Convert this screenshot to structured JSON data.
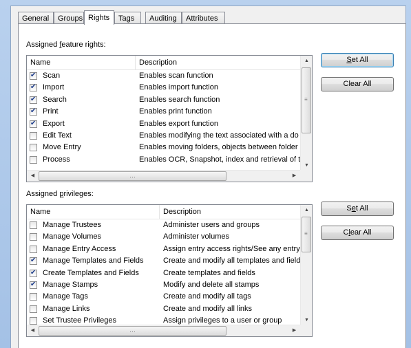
{
  "tabs": [
    {
      "label": "General"
    },
    {
      "label": "Groups"
    },
    {
      "label": "Rights"
    },
    {
      "label": "Tags"
    },
    {
      "label": "Auditing"
    },
    {
      "label": "Attributes"
    }
  ],
  "features": {
    "label_pre": "Assigned ",
    "label_key": "f",
    "label_post": "eature rights:",
    "columns": {
      "name": "Name",
      "description": "Description"
    },
    "rows": [
      {
        "name": "Scan",
        "description": "Enables scan function",
        "checked": true
      },
      {
        "name": "Import",
        "description": "Enables import function",
        "checked": true
      },
      {
        "name": "Search",
        "description": "Enables search function",
        "checked": true
      },
      {
        "name": "Print",
        "description": "Enables print function",
        "checked": true
      },
      {
        "name": "Export",
        "description": "Enables export function",
        "checked": true
      },
      {
        "name": "Edit Text",
        "description": "Enables modifying the text associated with a do",
        "checked": false
      },
      {
        "name": "Move Entry",
        "description": "Enables moving folders, objects between folder",
        "checked": false
      },
      {
        "name": "Process",
        "description": "Enables OCR, Snapshot, index and retrieval of t",
        "checked": false
      }
    ],
    "set_all": {
      "pre": "",
      "key": "S",
      "post": "et All"
    },
    "clear_all": {
      "pre": "Clear All",
      "key": "",
      "post": ""
    }
  },
  "privileges": {
    "label_pre": "Assigned ",
    "label_key": "p",
    "label_post": "rivileges:",
    "columns": {
      "name": "Name",
      "description": "Description"
    },
    "rows": [
      {
        "name": "Manage Trustees",
        "description": "Administer users and groups",
        "checked": false
      },
      {
        "name": "Manage Volumes",
        "description": "Administer volumes",
        "checked": false
      },
      {
        "name": "Manage Entry Access",
        "description": "Assign entry access rights/See any entry",
        "checked": false
      },
      {
        "name": "Manage Templates and Fields",
        "description": "Create and modify all templates and field",
        "checked": true
      },
      {
        "name": "Create Templates and Fields",
        "description": "Create templates and fields",
        "checked": true
      },
      {
        "name": "Manage Stamps",
        "description": "Modify and delete all stamps",
        "checked": true
      },
      {
        "name": "Manage Tags",
        "description": "Create and modify all tags",
        "checked": false
      },
      {
        "name": "Manage Links",
        "description": "Create and modify all links",
        "checked": false
      },
      {
        "name": "Set Trustee Privileges",
        "description": "Assign privileges to a user or group",
        "checked": false
      }
    ],
    "set_all": {
      "pre": "S",
      "key": "e",
      "post": "t All"
    },
    "clear_all": {
      "pre": "C",
      "key": "l",
      "post": "ear All"
    }
  },
  "icons": {
    "scroll_up": "scroll-up-arrow-icon",
    "scroll_down": "scroll-down-arrow-icon",
    "scroll_left": "scroll-left-arrow-icon",
    "scroll_right": "scroll-right-arrow-icon"
  }
}
